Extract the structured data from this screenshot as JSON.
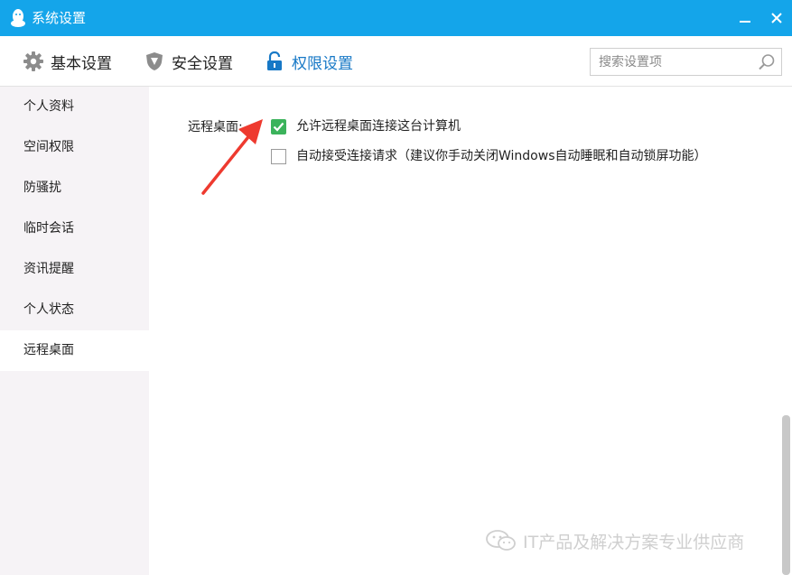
{
  "window": {
    "title": "系统设置",
    "minimize_symbol": "—",
    "close_symbol": "✕"
  },
  "toolbar": {
    "tabs": [
      {
        "label": "基本设置",
        "icon": "gear-icon"
      },
      {
        "label": "安全设置",
        "icon": "shield-icon"
      },
      {
        "label": "权限设置",
        "icon": "lock-icon",
        "active": true
      }
    ],
    "search": {
      "placeholder": "搜索设置项",
      "value": ""
    }
  },
  "sidebar": {
    "items": [
      {
        "label": "个人资料"
      },
      {
        "label": "空间权限"
      },
      {
        "label": "防骚扰"
      },
      {
        "label": "临时会话"
      },
      {
        "label": "资讯提醒"
      },
      {
        "label": "个人状态"
      },
      {
        "label": "远程桌面",
        "active": true
      }
    ]
  },
  "main": {
    "section_label": "远程桌面:",
    "options": [
      {
        "label": "允许远程桌面连接这台计算机",
        "checked": true
      },
      {
        "label": "自动接受连接请求（建议你手动关闭Windows自动睡眠和自动锁屏功能）",
        "checked": false
      }
    ]
  },
  "watermark": {
    "text": "IT产品及解决方案专业供应商"
  },
  "colors": {
    "titlebar": "#14a5ea",
    "active_tab": "#1778c6",
    "checkbox_checked": "#3bb35b",
    "arrow": "#ee3a2f",
    "sidebar_bg": "#f6f3f6"
  }
}
